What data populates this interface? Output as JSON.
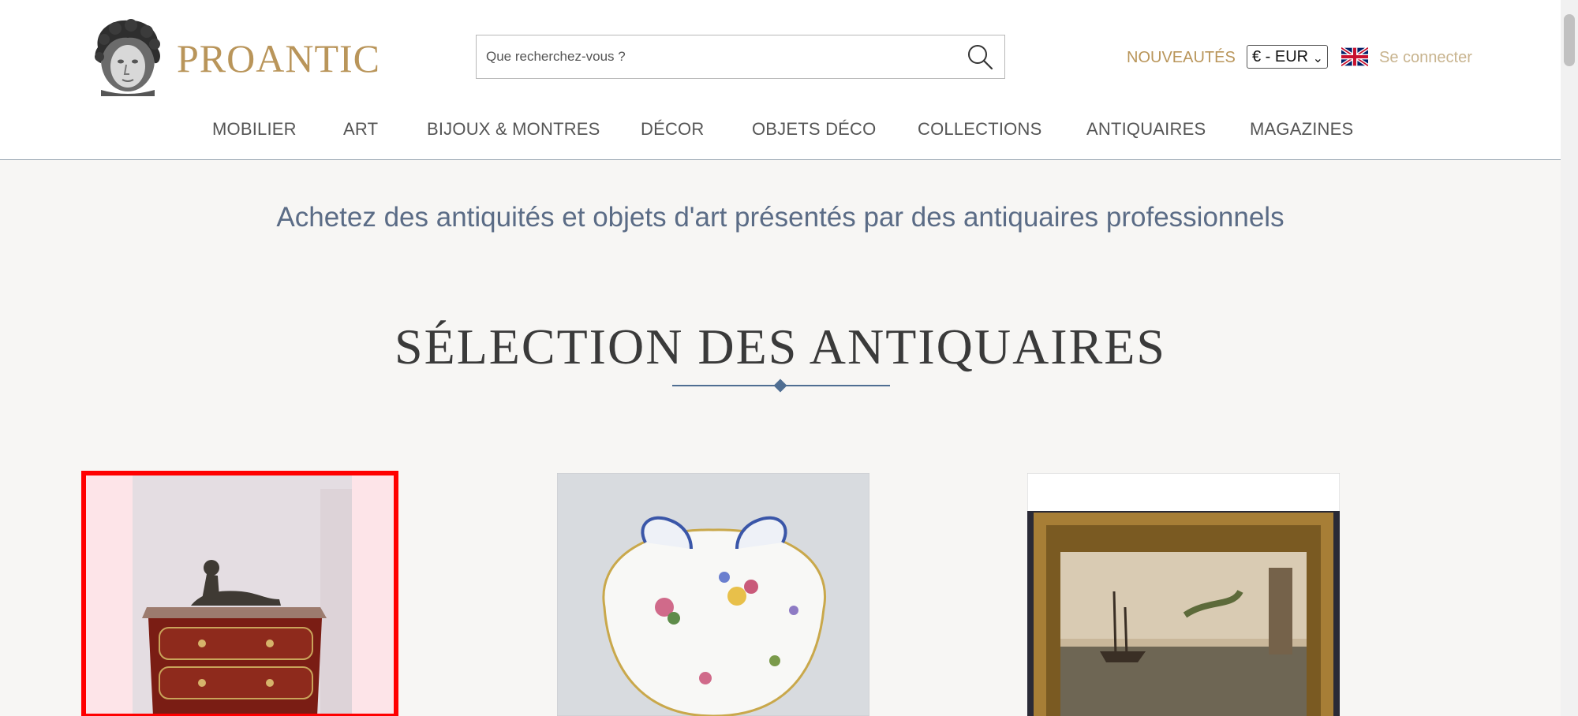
{
  "brand": {
    "name": "PROANTIC"
  },
  "search": {
    "placeholder": "Que recherchez-vous ?"
  },
  "header": {
    "new_label": "NOUVEAUTÉS",
    "currency": "€ - EUR",
    "language_flag": "uk-flag-icon",
    "login_label": "Se connecter"
  },
  "menu": [
    "MOBILIER",
    "ART",
    "BIJOUX & MONTRES",
    "DÉCOR",
    "OBJETS DÉCO",
    "COLLECTIONS",
    "ANTIQUAIRES",
    "MAGAZINES"
  ],
  "main": {
    "tagline": "Achetez des antiquités et objets d'art présentés par des antiquaires professionnels",
    "section_title": "SÉLECTION DES ANTIQUAIRES"
  },
  "colors": {
    "accent_gold": "#b9955a",
    "muted_gold": "#c8b48f",
    "tagline_blue": "#5b6c86",
    "divider_blue": "#4f6e92",
    "selection_red": "#ff0000"
  },
  "cards": [
    {
      "name": "commode-with-bronze-sculpture",
      "selected": true
    },
    {
      "name": "porcelain-shell-dish",
      "selected": false
    },
    {
      "name": "framed-marine-painting",
      "selected": false
    }
  ]
}
